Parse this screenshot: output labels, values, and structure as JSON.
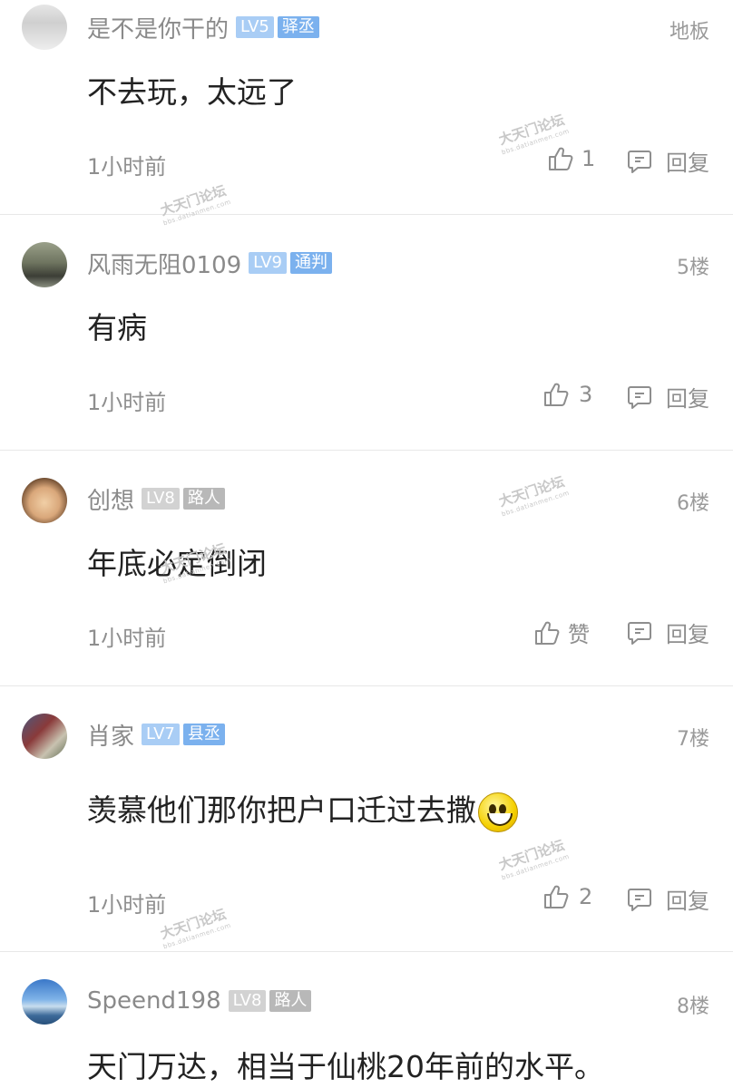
{
  "comments": [
    {
      "username": "是不是你干的",
      "level": "LV5",
      "title": "驿丞",
      "badge_color": "#7bb1ee",
      "floor": "地板",
      "content": "不去玩，太远了",
      "time": "1小时前",
      "likes": "1",
      "reply_label": "回复",
      "avatar": "avatar"
    },
    {
      "username": "风雨无阻0109",
      "level": "LV9",
      "title": "通判",
      "badge_color": "#7bb1ee",
      "floor": "5楼",
      "content": "有病",
      "time": "1小时前",
      "likes": "3",
      "reply_label": "回复",
      "avatar": "avatar"
    },
    {
      "username": "创想",
      "level": "LV8",
      "title": "路人",
      "badge_color": "#c4c4c4",
      "floor": "6楼",
      "content": "年底必定倒闭",
      "time": "1小时前",
      "likes": "赞",
      "reply_label": "回复",
      "avatar": "avatar"
    },
    {
      "username": "肖家",
      "level": "LV7",
      "title": "县丞",
      "badge_color": "#7bb1ee",
      "floor": "7楼",
      "content": "羡慕他们那你把户口迁过去撒",
      "time": "1小时前",
      "likes": "2",
      "reply_label": "回复",
      "avatar": "avatar",
      "emoji": "grinning-face"
    },
    {
      "username": "Speend198",
      "level": "LV8",
      "title": "路人",
      "badge_color": "#c4c4c4",
      "floor": "8楼",
      "content": "天门万达，相当于仙桃20年前的水平。",
      "avatar": "avatar"
    }
  ],
  "watermark": {
    "main": "大天门论坛",
    "sub": "bbs.datianmen.com"
  },
  "icons": {
    "like": "thumbs-up-icon",
    "reply": "comment-icon"
  }
}
